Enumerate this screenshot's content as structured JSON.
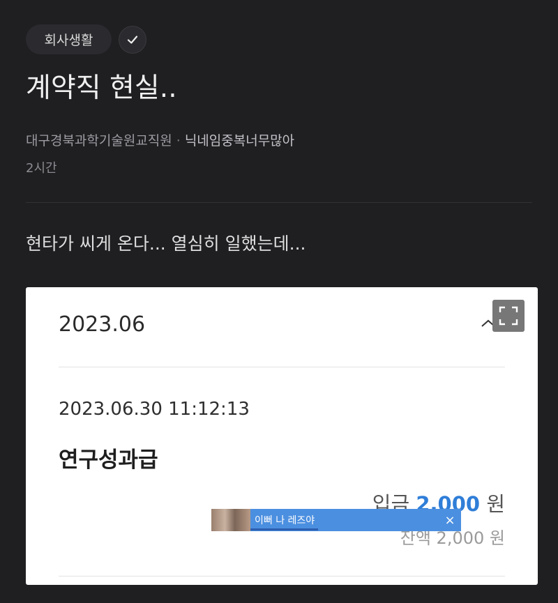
{
  "post": {
    "category": "회사생활",
    "title": "계약직 현실..",
    "company": "대구경북과학기술원교직원",
    "separator": "·",
    "nickname": "닉네임중복너무많아",
    "time_ago": "2시간",
    "body": "현타가 씨게 온다... 열심히 일했는데..."
  },
  "statement": {
    "month": "2023.06",
    "datetime": "2023.06.30 11:12:13",
    "description": "연구성과급",
    "deposit_label": "입금",
    "deposit_amount": "2,000",
    "currency": "원",
    "balance_label": "잔액",
    "balance_amount": "2,000"
  },
  "ad": {
    "text": "이뻐 나 레즈야",
    "close": "×"
  },
  "icons": {
    "check": "check-icon",
    "expand": "expand-icon",
    "chevron": "chevron-up-icon"
  },
  "colors": {
    "background": "#1f1e21",
    "accent_amount": "#2f7ed8",
    "ad_background": "#4b8fe0"
  }
}
